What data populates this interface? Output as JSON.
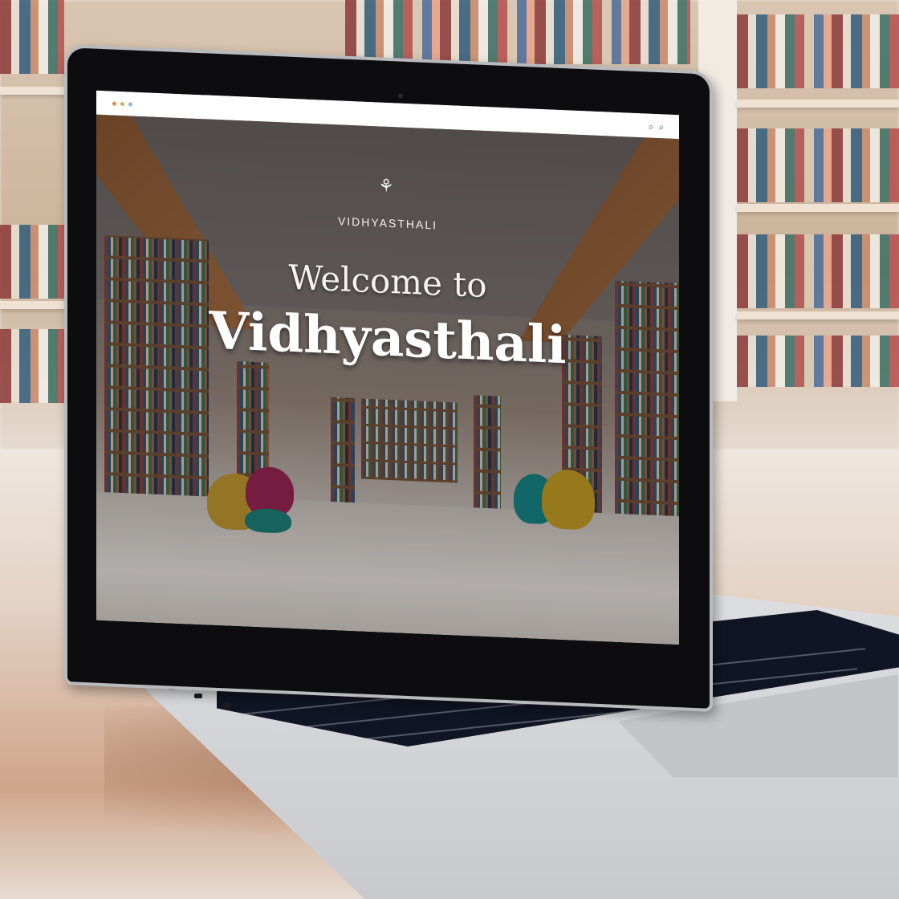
{
  "site": {
    "brand": "VIDHYASTHALI",
    "welcome_line": "Welcome to",
    "title": "Vidhyasthali"
  },
  "icons": {
    "logo": "lotus-icon",
    "search": "search-icon"
  },
  "colors": {
    "hero_text": "#ffffff",
    "browser_bar": "#ffffff",
    "dot1": "#d98c4b",
    "dot2": "#c9b16a",
    "dot3": "#8fb0d6"
  }
}
